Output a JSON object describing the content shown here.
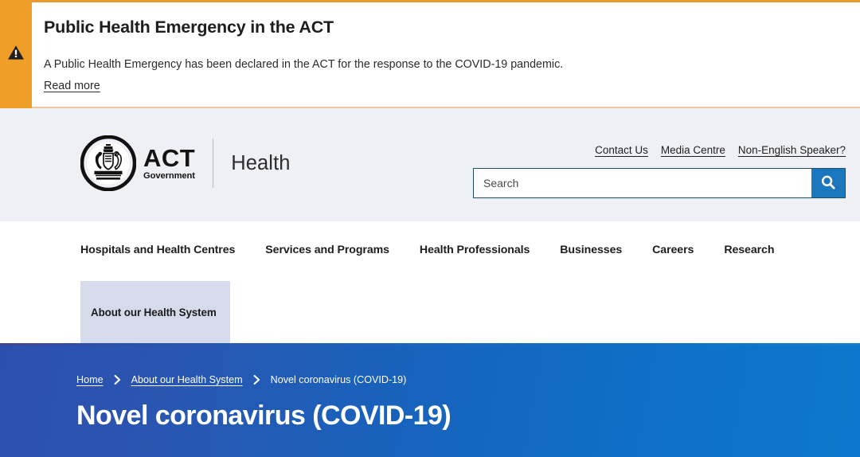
{
  "alert": {
    "icon": "warning-triangle-icon",
    "title": "Public Health Emergency in the ACT",
    "text": "A Public Health Emergency has been declared in the ACT for the response to the COVID-19 pandemic.",
    "read_more": "Read more",
    "stripe_color": "#ef9f28",
    "border_color": "#e89b2c"
  },
  "header": {
    "logo": {
      "crest_alt": "act-government-coat-of-arms",
      "act": "ACT",
      "government": "Government",
      "health": "Health"
    },
    "utility_links": [
      {
        "label": "Contact Us"
      },
      {
        "label": "Media Centre"
      },
      {
        "label": "Non-English Speaker?"
      }
    ],
    "search": {
      "placeholder": "Search",
      "value": "",
      "button_icon": "search-icon",
      "button_color": "#1b77bd",
      "border_color": "#1c4f6b"
    },
    "background": "#eef0f5"
  },
  "nav": {
    "items": [
      {
        "label": "Hospitals and Health Centres"
      },
      {
        "label": "Services and Programs"
      },
      {
        "label": "Health Professionals"
      },
      {
        "label": "Businesses"
      },
      {
        "label": "Careers"
      },
      {
        "label": "Research"
      }
    ],
    "mega_panel": {
      "label": "About our Health System",
      "background": "#d6dbeb"
    }
  },
  "hero": {
    "breadcrumb": [
      {
        "label": "Home",
        "link": true
      },
      {
        "label": "About our Health System",
        "link": true
      },
      {
        "label": "Novel coronavirus (COVID-19)",
        "link": false
      }
    ],
    "separator_icon": "chevron-right-icon",
    "title": "Novel coronavirus (COVID-19)",
    "gradient_from": "#2c4fad",
    "gradient_to": "#0c77cc"
  }
}
